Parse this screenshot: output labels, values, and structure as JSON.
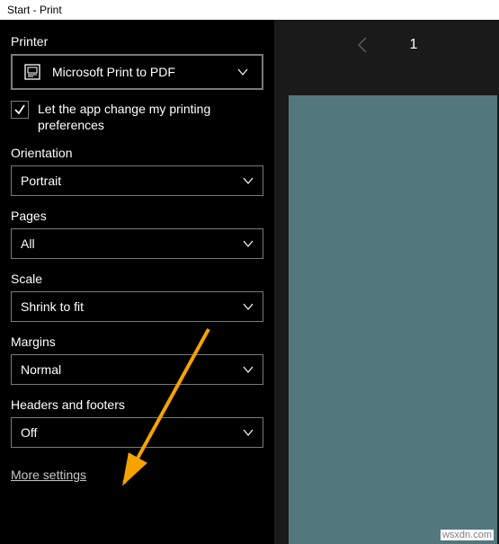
{
  "window": {
    "title": "Start - Print"
  },
  "printer": {
    "label": "Printer",
    "value": "Microsoft Print to PDF"
  },
  "checkbox": {
    "checked": true,
    "label": "Let the app change my printing preferences"
  },
  "orientation": {
    "label": "Orientation",
    "value": "Portrait"
  },
  "pages": {
    "label": "Pages",
    "value": "All"
  },
  "scale": {
    "label": "Scale",
    "value": "Shrink to fit"
  },
  "margins": {
    "label": "Margins",
    "value": "Normal"
  },
  "headers_footers": {
    "label": "Headers and footers",
    "value": "Off"
  },
  "more_settings": "More settings",
  "preview": {
    "current_page": "1"
  },
  "watermark": "wsxdn.com"
}
